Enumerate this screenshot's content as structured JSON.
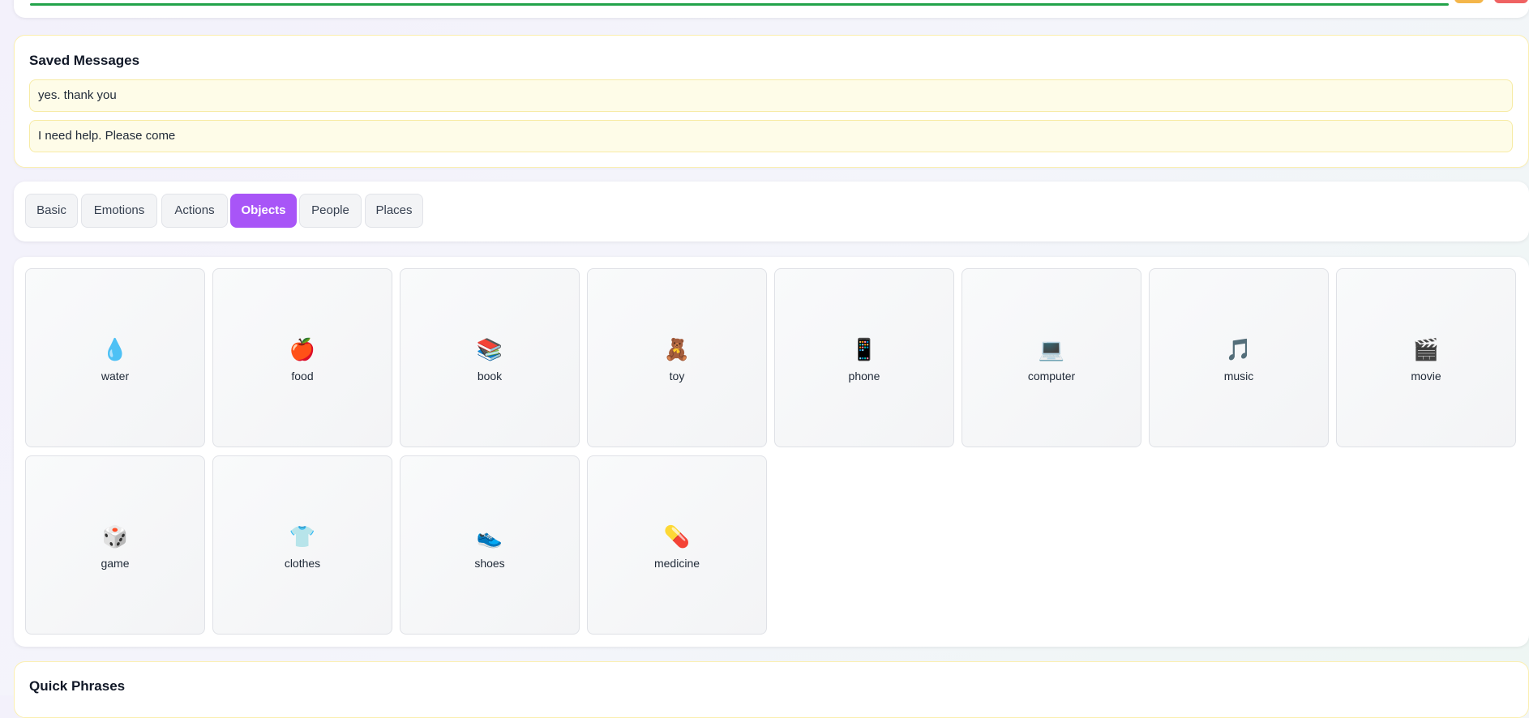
{
  "header": {
    "progress_color": "#22a34a",
    "accent_colors": [
      "#f4b64a",
      "#ef6262"
    ]
  },
  "saved_messages": {
    "title": "Saved Messages",
    "items": [
      "yes. thank you",
      "I need help. Please come"
    ]
  },
  "categories": {
    "active": "Objects",
    "active_color": "#a855f7",
    "tabs": [
      "Basic",
      "Emotions",
      "Actions",
      "Objects",
      "People",
      "Places"
    ]
  },
  "symbols": [
    {
      "label": "water",
      "icon": "droplet-icon",
      "glyph": "💧"
    },
    {
      "label": "food",
      "icon": "apple-icon",
      "glyph": "🍎"
    },
    {
      "label": "book",
      "icon": "books-icon",
      "glyph": "📚"
    },
    {
      "label": "toy",
      "icon": "teddy-bear-icon",
      "glyph": "🧸"
    },
    {
      "label": "phone",
      "icon": "phone-icon",
      "glyph": "📱"
    },
    {
      "label": "computer",
      "icon": "laptop-icon",
      "glyph": "💻"
    },
    {
      "label": "music",
      "icon": "music-note-icon",
      "glyph": "🎵"
    },
    {
      "label": "movie",
      "icon": "clapper-icon",
      "glyph": "🎬"
    },
    {
      "label": "game",
      "icon": "dice-icon",
      "glyph": "🎲"
    },
    {
      "label": "clothes",
      "icon": "shirt-icon",
      "glyph": "👕"
    },
    {
      "label": "shoes",
      "icon": "sneaker-icon",
      "glyph": "👟"
    },
    {
      "label": "medicine",
      "icon": "pill-icon",
      "glyph": "💊"
    }
  ],
  "quick_phrases": {
    "title": "Quick Phrases"
  }
}
